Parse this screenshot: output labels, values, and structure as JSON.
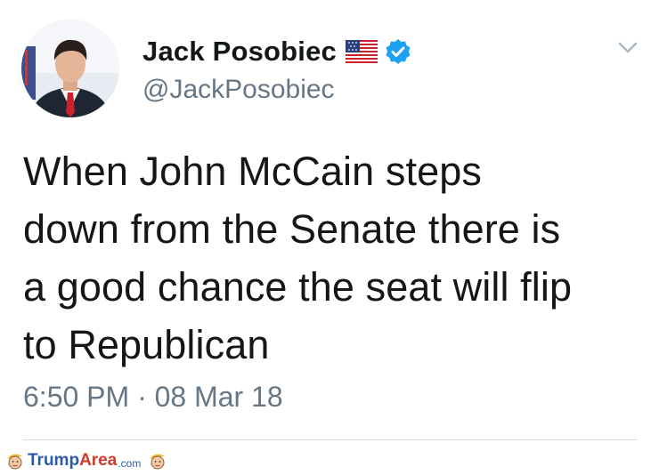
{
  "tweet": {
    "display_name": "Jack Posobiec",
    "handle": "@JackPosobiec",
    "text_lines": [
      "When John McCain steps",
      "down from the Senate there is",
      "a good chance the seat will flip",
      "to Republican"
    ],
    "timestamp": "6:50 PM · 08 Mar 18"
  },
  "icons": {
    "flag": "us-flag-icon",
    "verified": "verified-badge-icon",
    "menu": "chevron-down-icon"
  },
  "colors": {
    "verified": "#1da1f2",
    "text": "#14171a",
    "secondary": "#657786"
  },
  "watermark": {
    "brand_part1": "Trump",
    "brand_part2": "Area",
    "brand_suffix": ".com"
  }
}
